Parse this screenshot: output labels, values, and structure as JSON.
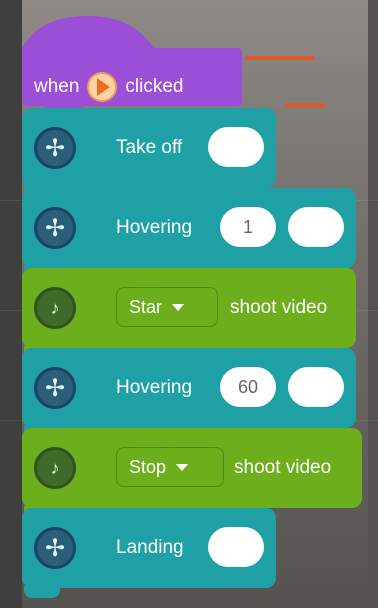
{
  "event": {
    "when": "when",
    "clicked": "clicked"
  },
  "blocks": [
    {
      "type": "drone",
      "label": "Take off"
    },
    {
      "type": "drone",
      "label": "Hovering",
      "value": "1"
    },
    {
      "type": "camera",
      "dropdown": "Star",
      "tail": "shoot video"
    },
    {
      "type": "drone",
      "label": "Hovering",
      "value": "60"
    },
    {
      "type": "camera",
      "dropdown": "Stop",
      "tail": "shoot video"
    },
    {
      "type": "drone",
      "label": "Landing"
    }
  ],
  "icons": {
    "play": "play-icon",
    "drone": "drone-icon",
    "camera": "camera-icon",
    "caret": "chevron-down-icon"
  },
  "colors": {
    "hat": "#9b4fd6",
    "teal": "#1fa0a5",
    "green": "#6cae1c"
  }
}
